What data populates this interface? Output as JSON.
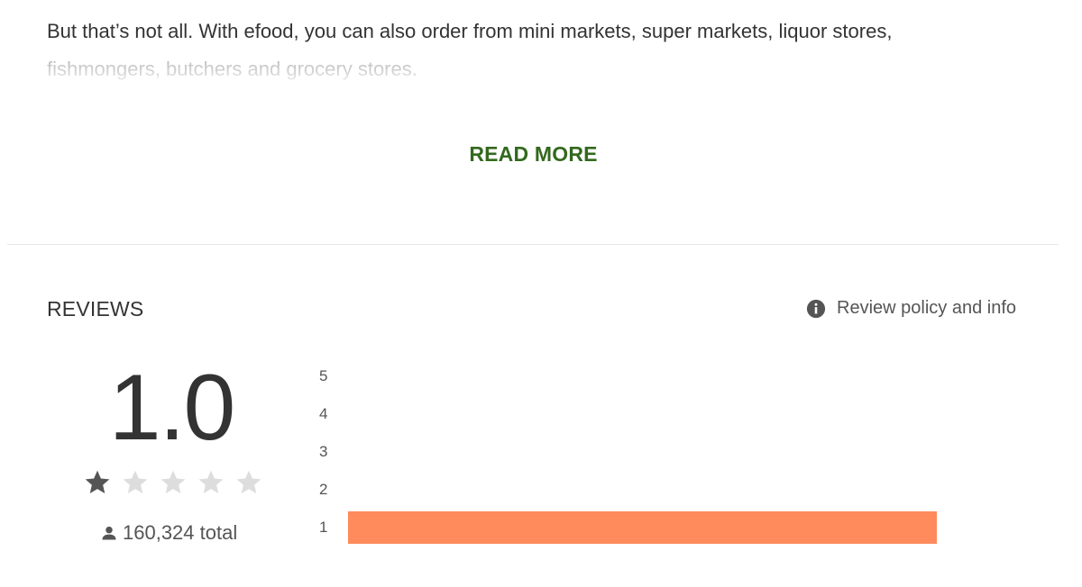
{
  "description": {
    "text_line_1": "But that’s not all. With efood, you can also order from mini markets, super markets, liquor stores,",
    "text_line_2": "fishmongers, butchers and grocery stores."
  },
  "read_more_label": "READ MORE",
  "reviews": {
    "title": "REVIEWS",
    "policy_label": "Review policy and info",
    "average_score": "1.0",
    "star_rating": 1,
    "max_stars": 5,
    "total_count": "160,324 total",
    "histogram": [
      {
        "label": "5",
        "fraction": 0.0
      },
      {
        "label": "4",
        "fraction": 0.0
      },
      {
        "label": "3",
        "fraction": 0.0
      },
      {
        "label": "2",
        "fraction": 0.0
      },
      {
        "label": "1",
        "fraction": 1.0
      }
    ]
  },
  "colors": {
    "link_green": "#33691e",
    "bar_orange": "#ff8a5c",
    "star_filled": "#555555",
    "star_empty": "#dddddd"
  },
  "icons": {
    "info": "info-icon",
    "person": "person-icon",
    "star": "star-icon"
  }
}
